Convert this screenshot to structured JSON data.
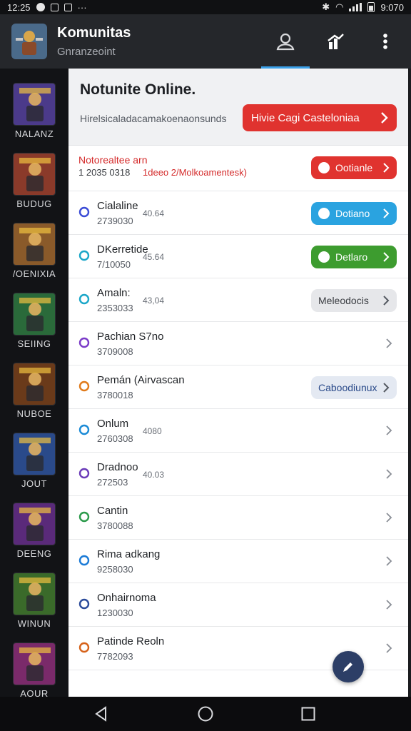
{
  "status": {
    "time_left": "12:25",
    "time_right": "9:070"
  },
  "app": {
    "title": "Komunitas",
    "subtitle": "Gnranzeoint"
  },
  "rail": [
    {
      "label": "NALANZ",
      "color": "#4b3a8a"
    },
    {
      "label": "BUDUG",
      "color": "#8a3a2a"
    },
    {
      "label": "/OENIXIA",
      "color": "#8a5a2a"
    },
    {
      "label": "SEIING",
      "color": "#2a6a3a"
    },
    {
      "label": "NUBOE",
      "color": "#6a3a1a"
    },
    {
      "label": "JOUT",
      "color": "#2a4a8a"
    },
    {
      "label": "DEENG",
      "color": "#5a2a7a"
    },
    {
      "label": "WINUN",
      "color": "#3a6a2a"
    },
    {
      "label": "AOUR",
      "color": "#7a2a6a"
    }
  ],
  "panel": {
    "title": "Notunite Online.",
    "desc": "Hirelsicaladacamakoenaonsunds",
    "cta": "Hivie Cagi Casteloniaa"
  },
  "rows": [
    {
      "name": "Notorealtee arn",
      "id": "1 2035 0318",
      "meta": "1deeo 2/Molkoamentesk)",
      "pill": "Ootianle",
      "pill_color": "#e0332f",
      "icon_color": "#d42a2a"
    },
    {
      "name": "Cialaline",
      "id": "2739030",
      "meta": "40.64",
      "pill": "Dotiano",
      "pill_color": "#2aa3e0",
      "icon_color": "#3a4bd6"
    },
    {
      "name": "DKerretide",
      "id": "7/10050",
      "meta": "45.64",
      "pill": "Detlaro",
      "pill_color": "#3d9c2f",
      "icon_color": "#1aa6c8"
    },
    {
      "name": "Amaln:",
      "id": "2353033",
      "meta": "43,04",
      "pill": "Meleodocis",
      "pill_color": "#e6e7ea",
      "icon_color": "#1aa6c8"
    },
    {
      "name": "Pachian S7no",
      "id": "3709008",
      "meta": "",
      "pill": "",
      "pill_color": "",
      "icon_color": "#7a3ac8"
    },
    {
      "name": "Pemán (Airvascan",
      "id": "3780018",
      "meta": "",
      "pill": "Caboodiunux",
      "pill_color": "#e4e9f2",
      "icon_color": "#e07a1a"
    },
    {
      "name": "Onlum",
      "id": "2760308",
      "meta": "4080",
      "pill": "",
      "pill_color": "",
      "icon_color": "#1a8ad6"
    },
    {
      "name": "Dradnoo",
      "id": "272503",
      "meta": "40.03",
      "pill": "",
      "pill_color": "",
      "icon_color": "#6a3ab8"
    },
    {
      "name": "Cantin",
      "id": "3780088",
      "meta": "",
      "pill": "",
      "pill_color": "",
      "icon_color": "#2a9a4a"
    },
    {
      "name": "Rima adkang",
      "id": "9258030",
      "meta": "",
      "pill": "",
      "pill_color": "",
      "icon_color": "#1a7ad6"
    },
    {
      "name": "Onhairnoma",
      "id": "1230030",
      "meta": "",
      "pill": "",
      "pill_color": "",
      "icon_color": "#2a4a9a"
    },
    {
      "name": "Patinde Reoln",
      "id": "7782093",
      "meta": "",
      "pill": "",
      "pill_color": "",
      "icon_color": "#d6621a"
    }
  ],
  "icons": {
    "profile": "person-icon",
    "stats": "chart-icon",
    "more": "more-vert-icon",
    "fab": "edit-icon"
  }
}
